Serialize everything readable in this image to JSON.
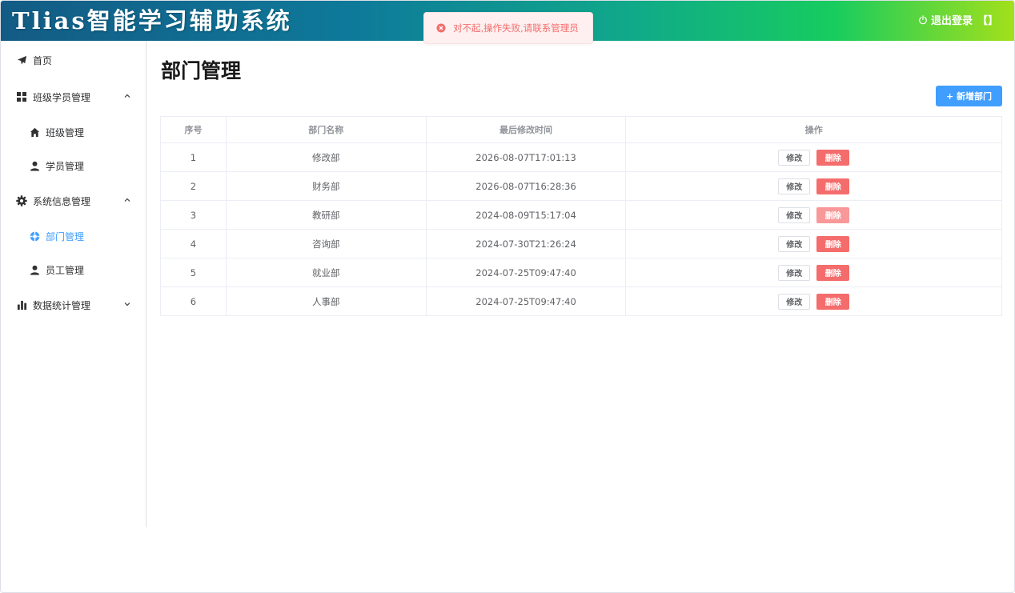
{
  "header": {
    "app_title": "Tlias智能学习辅助系统",
    "logout_label": "退出登录",
    "bracket": "【】"
  },
  "toast": {
    "message": "对不起,操作失败,请联系管理员",
    "color": "#f56c6c"
  },
  "sidebar": {
    "items": [
      {
        "label": "首页",
        "icon": "paper-plane-icon"
      },
      {
        "label": "班级学员管理",
        "icon": "grid-icon",
        "expanded": true
      },
      {
        "label": "班级管理",
        "icon": "home-icon"
      },
      {
        "label": "学员管理",
        "icon": "user-icon"
      },
      {
        "label": "系统信息管理",
        "icon": "gear-icon",
        "expanded": true
      },
      {
        "label": "部门管理",
        "icon": "help-circle-icon",
        "active": true
      },
      {
        "label": "员工管理",
        "icon": "users-icon"
      },
      {
        "label": "数据统计管理",
        "icon": "bar-chart-icon",
        "expanded": false
      }
    ]
  },
  "main": {
    "page_title": "部门管理",
    "add_button": "+ 新增部门",
    "accent_color": "#409eff",
    "table": {
      "headers": [
        "序号",
        "部门名称",
        "最后修改时间",
        "操作"
      ],
      "edit_label": "修改",
      "delete_label": "删除",
      "rows": [
        {
          "no": "1",
          "name": "修改部",
          "time": "2026-08-07T17:01:13"
        },
        {
          "no": "2",
          "name": "财务部",
          "time": "2026-08-07T16:28:36"
        },
        {
          "no": "3",
          "name": "教研部",
          "time": "2024-08-09T15:17:04"
        },
        {
          "no": "4",
          "name": "咨询部",
          "time": "2024-07-30T21:26:24"
        },
        {
          "no": "5",
          "name": "就业部",
          "time": "2024-07-25T09:47:40"
        },
        {
          "no": "6",
          "name": "人事部",
          "time": "2024-07-25T09:47:40"
        }
      ]
    }
  }
}
